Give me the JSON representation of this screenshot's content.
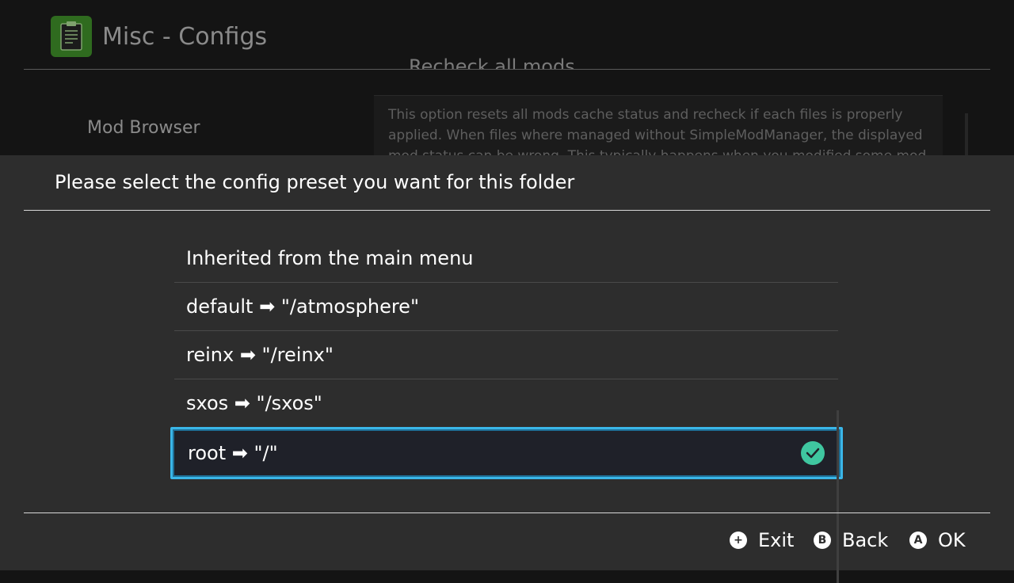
{
  "app": {
    "title": "Misc - Configs",
    "icon": "document-icon"
  },
  "background": {
    "clipped_item": "Recheck all mods",
    "sidebar_item": "Mod Browser",
    "description": "This option resets all mods cache status and recheck if each files is properly applied. When files where managed without SimpleModManager, the displayed mod status can be wrong. This typically happens when you modified some mod files, or other"
  },
  "dialog": {
    "title": "Please select the config preset you want for this folder",
    "items": [
      {
        "label": "Inherited from the main menu",
        "selected": false
      },
      {
        "label": "default ➡ \"/atmosphere\"",
        "selected": false
      },
      {
        "label": "reinx ➡ \"/reinx\"",
        "selected": false
      },
      {
        "label": "sxos ➡ \"/sxos\"",
        "selected": false
      },
      {
        "label": "root ➡ \"/\"",
        "selected": true
      }
    ]
  },
  "footer": {
    "exit": {
      "glyph": "+",
      "label": "Exit"
    },
    "back": {
      "glyph": "B",
      "label": "Back"
    },
    "ok": {
      "glyph": "A",
      "label": "OK"
    }
  },
  "colors": {
    "highlight_border": "#3ab6e8",
    "check": "#3fc6a0",
    "dialog_bg": "#2d2d2d"
  }
}
